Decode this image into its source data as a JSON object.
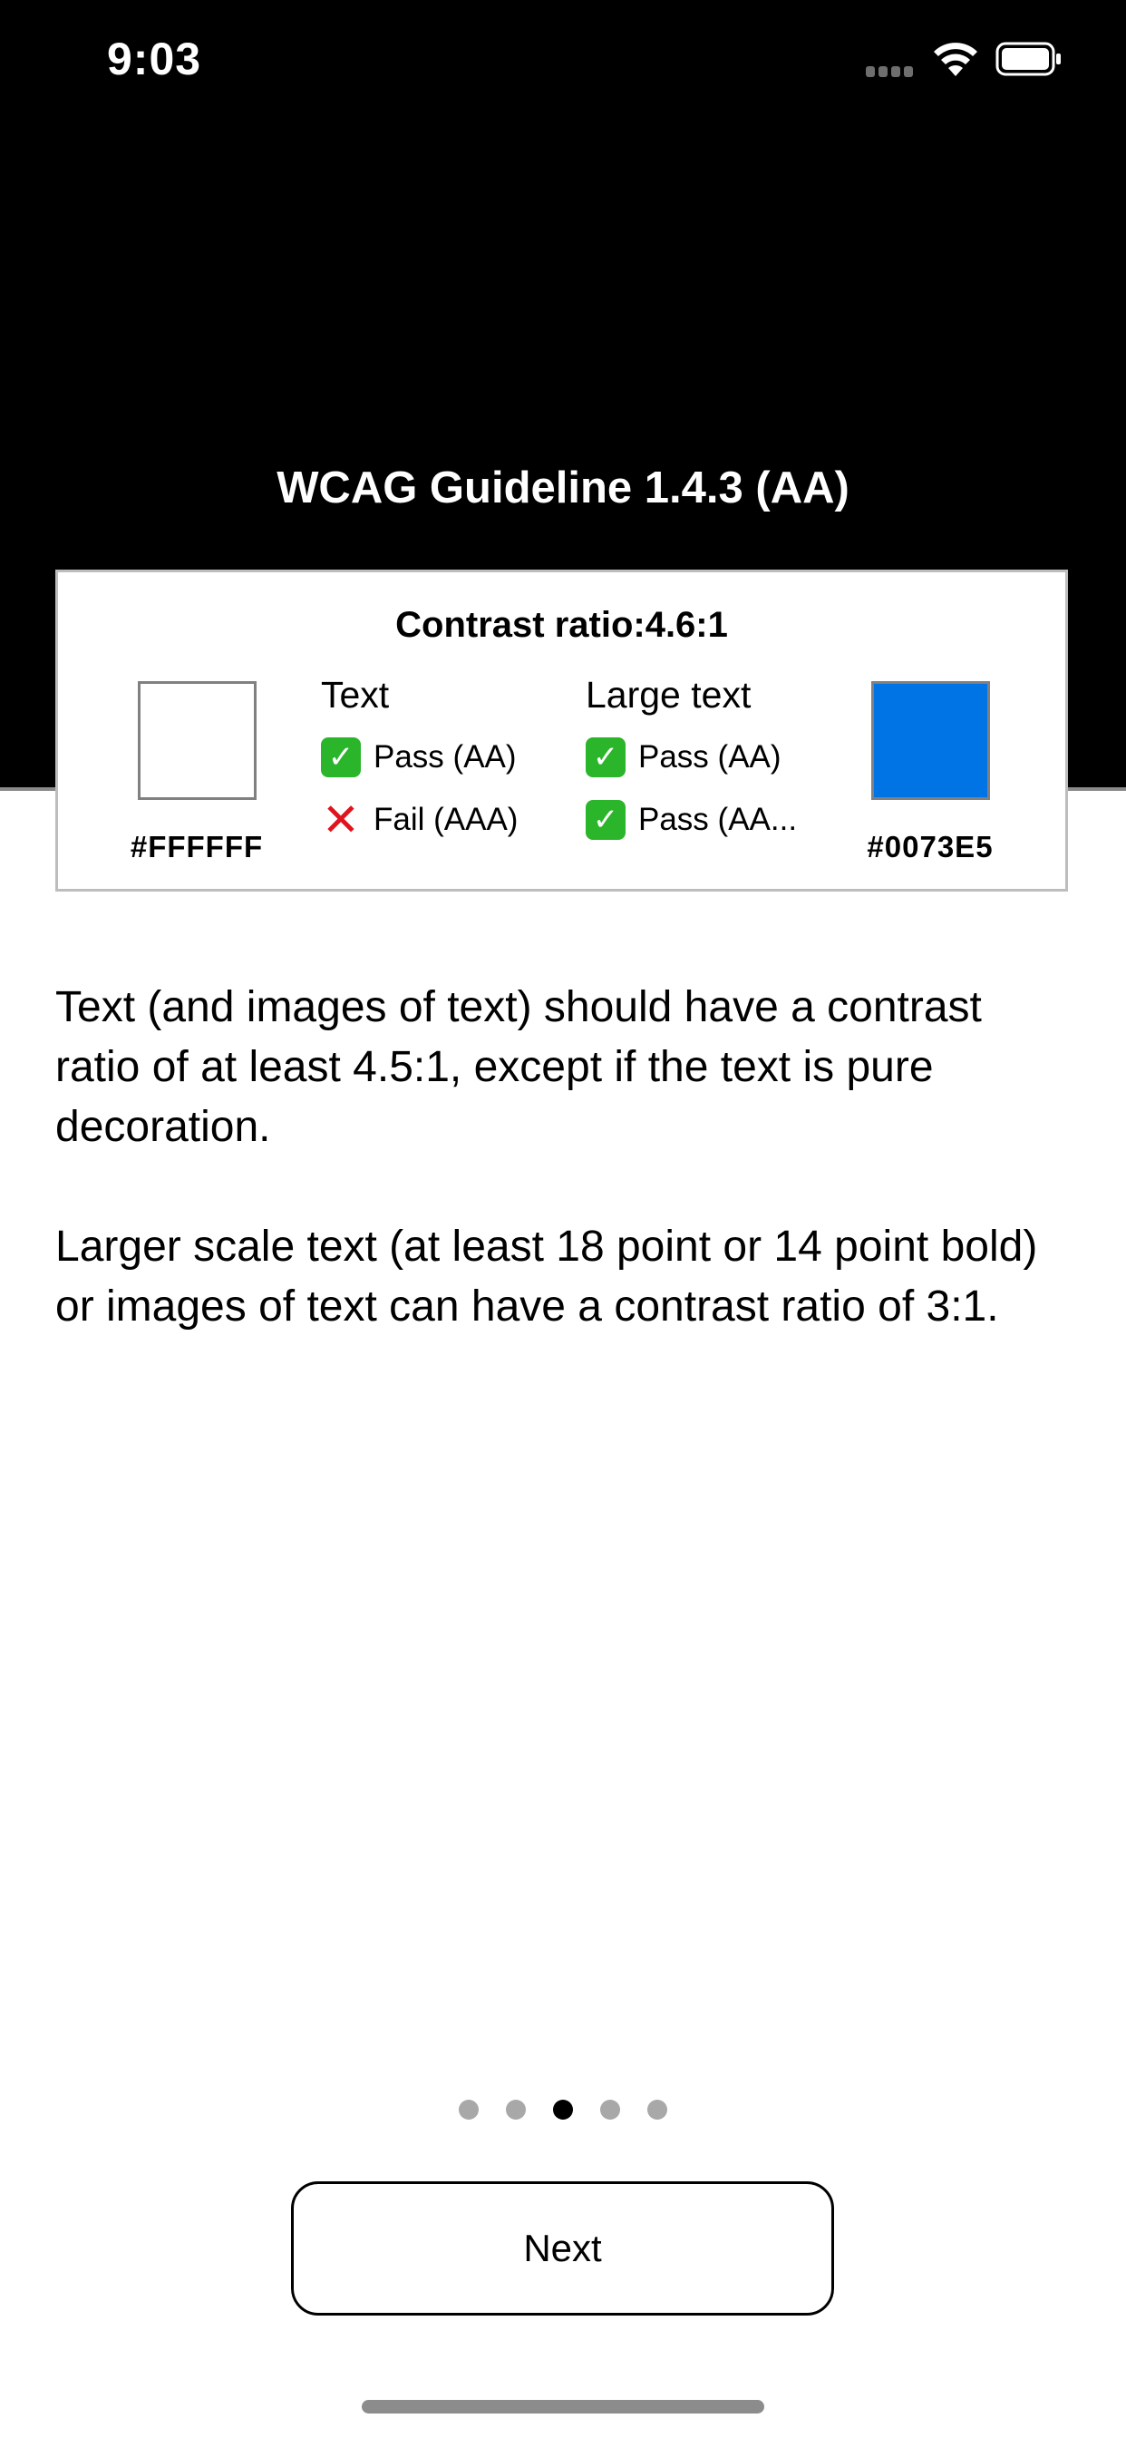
{
  "status_bar": {
    "time": "9:03",
    "icons": [
      "cellular-signal-icon",
      "wifi-icon",
      "battery-icon"
    ]
  },
  "header": {
    "title": "WCAG Guideline 1.4.3 (AA)"
  },
  "contrast_card": {
    "ratio_text": "Contrast ratio:4.6:1",
    "foreground": {
      "hex": "#FFFFFF",
      "color": "#FFFFFF"
    },
    "background": {
      "hex": "#0073E5",
      "color": "#0073E5"
    },
    "text_column": {
      "heading": "Text",
      "results": [
        {
          "status": "pass",
          "icon": "check-icon",
          "label": "Pass (AA)"
        },
        {
          "status": "fail",
          "icon": "cross-icon",
          "label": "Fail (AAA)"
        }
      ]
    },
    "large_text_column": {
      "heading": "Large text",
      "results": [
        {
          "status": "pass",
          "icon": "check-icon",
          "label": "Pass (AA)"
        },
        {
          "status": "pass",
          "icon": "check-icon",
          "label": "Pass (AA..."
        }
      ]
    }
  },
  "description": {
    "paragraph1": "Text (and images of text) should have a contrast ratio of at least 4.5:1, except if the text is pure decoration.",
    "paragraph2": "Larger scale text (at least 18 point or 14 point bold) or images of text can have a contrast ratio of 3:1."
  },
  "pager": {
    "total": 5,
    "current": 3
  },
  "footer": {
    "next_label": "Next"
  },
  "colors": {
    "pass": "#2BB52B",
    "fail": "#E0141E"
  }
}
